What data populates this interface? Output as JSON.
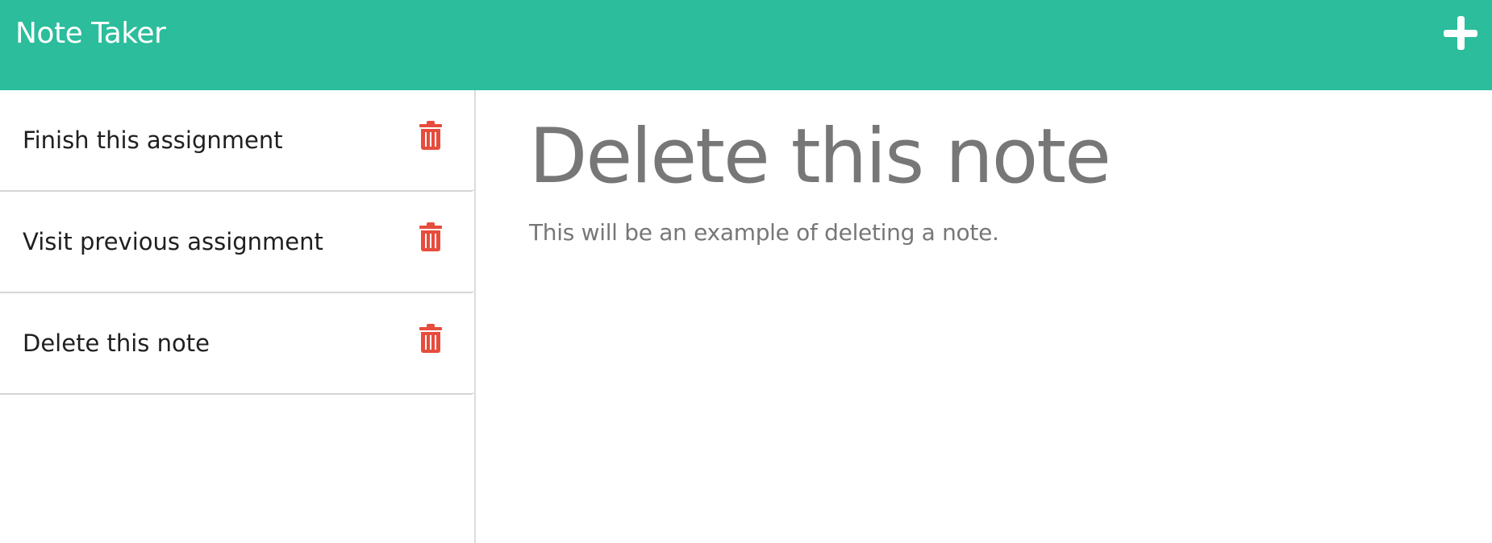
{
  "app": {
    "title": "Note Taker"
  },
  "header": {
    "new_note_icon": "plus-icon"
  },
  "sidebar": {
    "notes": [
      {
        "title": "Finish this assignment",
        "icon": "trash-icon"
      },
      {
        "title": "Visit previous assignment",
        "icon": "trash-icon"
      },
      {
        "title": "Delete this note",
        "icon": "trash-icon"
      }
    ]
  },
  "active_note": {
    "title": "Delete this note",
    "text": "This will be an example of deleting a note."
  },
  "colors": {
    "header_background": "#2bbd9c",
    "delete_icon": "#e74c3c",
    "note_text": "#777777"
  }
}
